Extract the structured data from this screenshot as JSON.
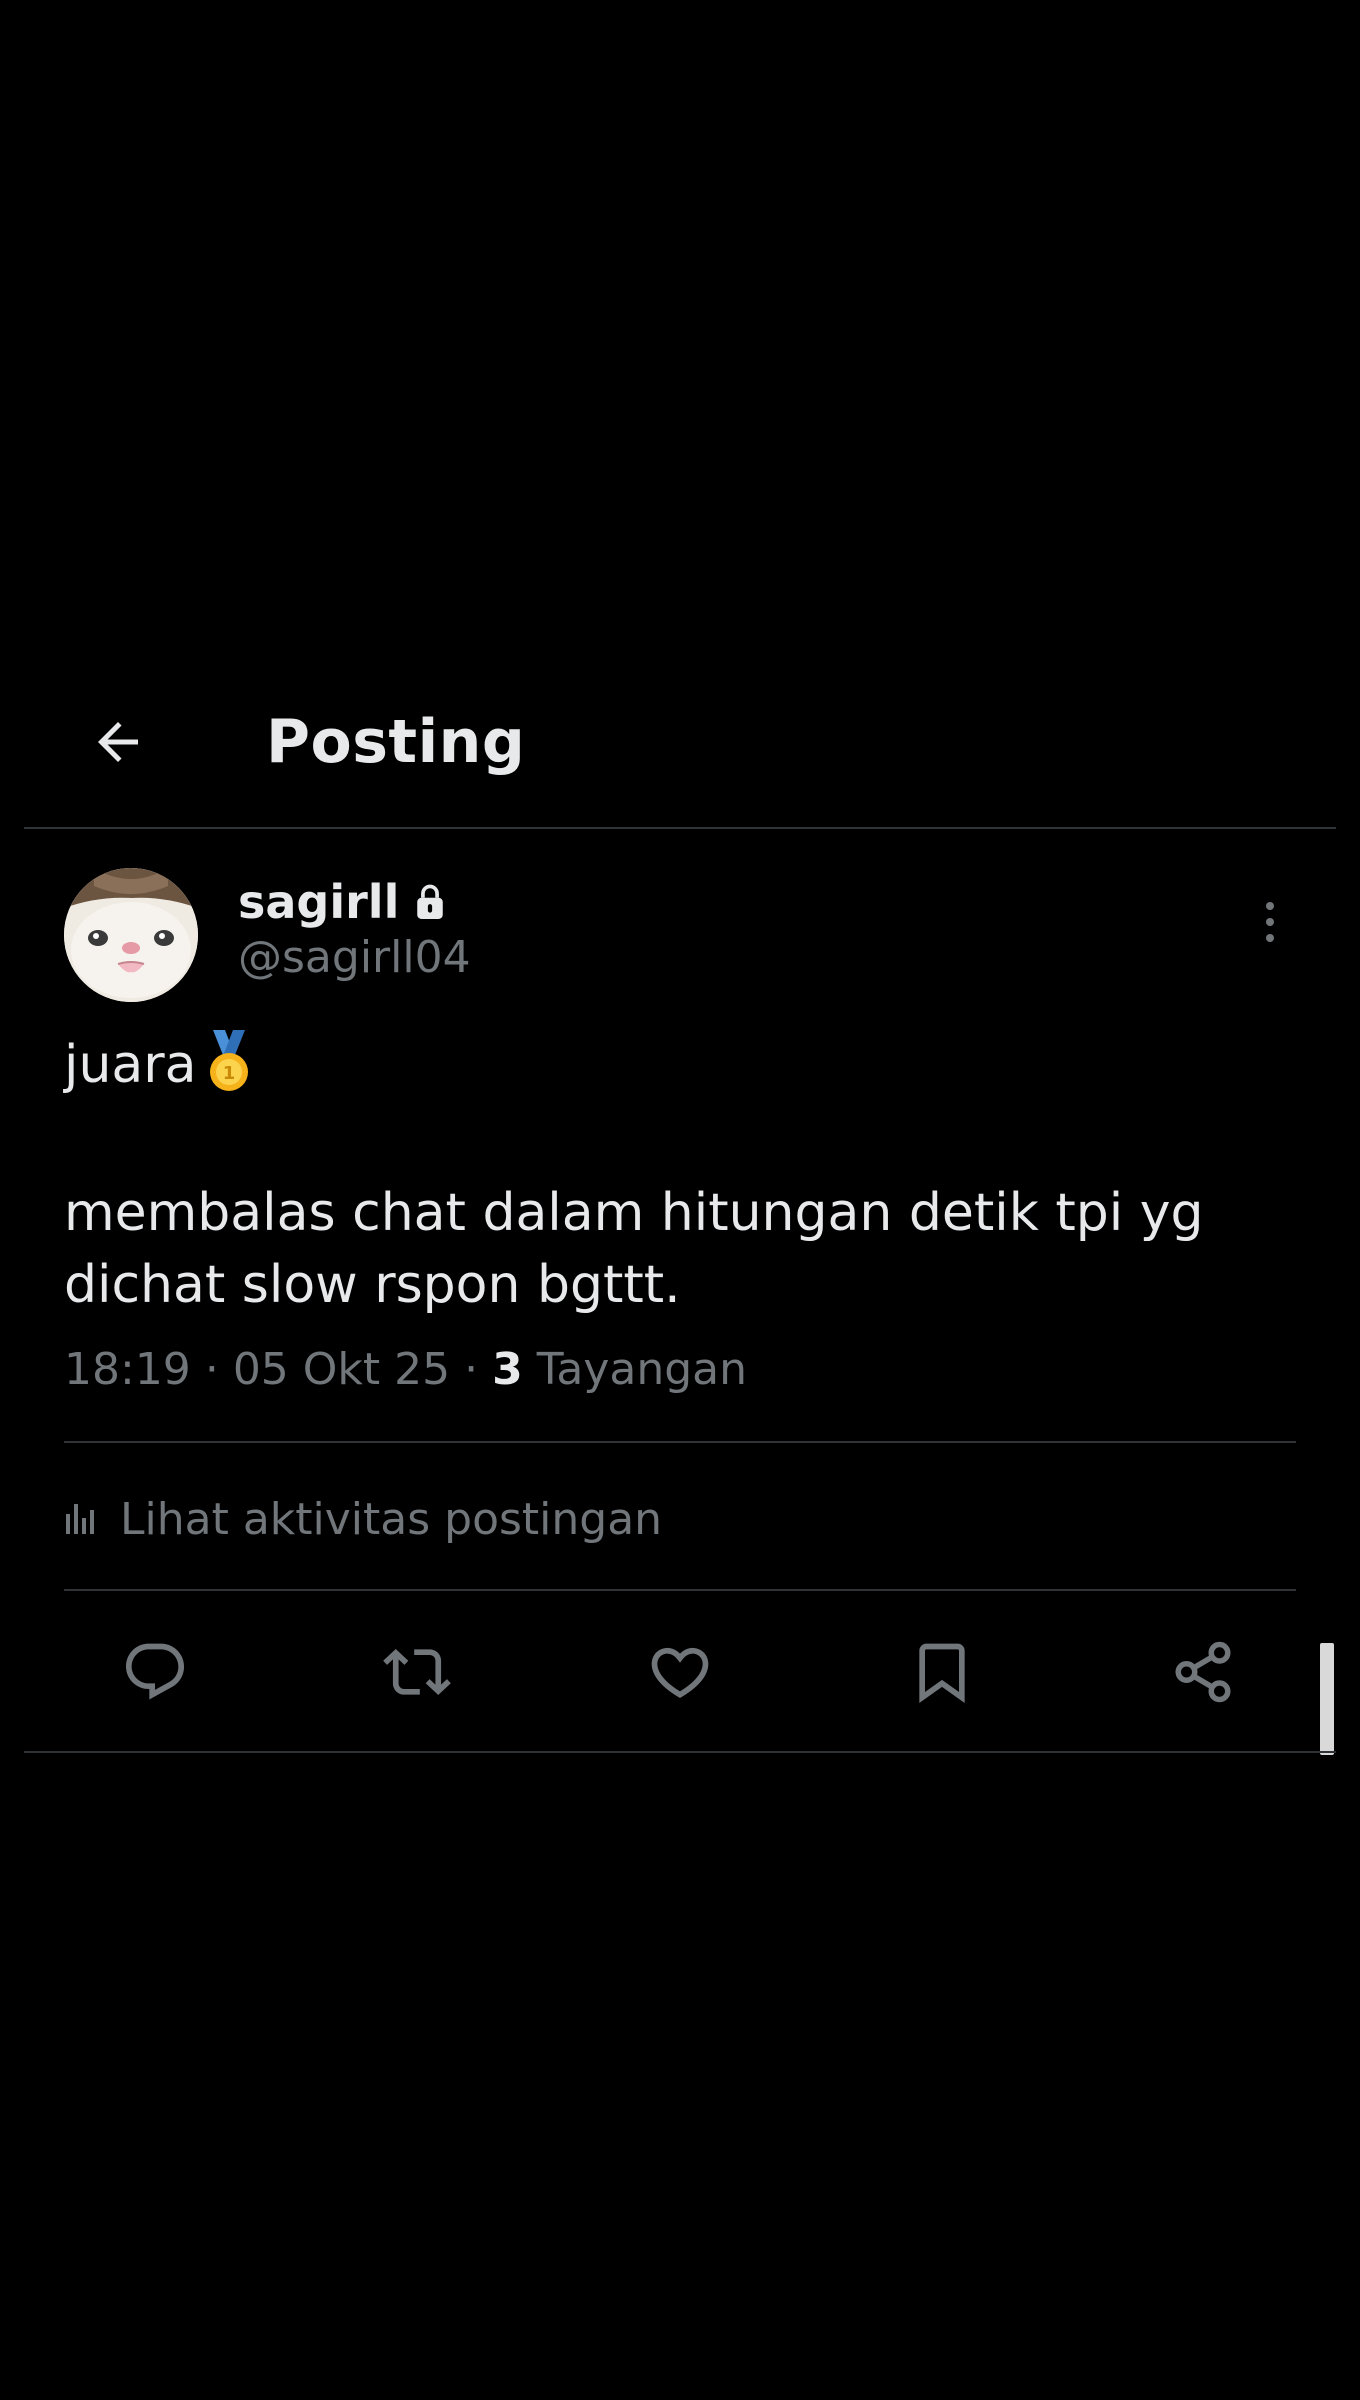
{
  "header": {
    "title": "Posting",
    "back_icon": "arrow-left-icon"
  },
  "post": {
    "author": {
      "display_name": "sagirll",
      "handle": "@sagirll04",
      "protected_icon": "lock-icon",
      "avatar": "cat-avatar"
    },
    "text_line1": "juara",
    "text_emoji": "medal-icon",
    "text_line2": "membalas chat dalam hitungan detik tpi yg",
    "text_line3": "dichat slow rspon bgttt.",
    "time": "18:19",
    "separator": "·",
    "date": "05 Okt 25",
    "views_count": "3",
    "views_label": "Tayangan",
    "activity_label": "Lihat aktivitas postingan"
  },
  "actions": [
    {
      "name": "reply",
      "icon": "reply-icon"
    },
    {
      "name": "repost",
      "icon": "repost-icon"
    },
    {
      "name": "like",
      "icon": "heart-icon"
    },
    {
      "name": "bookmark",
      "icon": "bookmark-icon"
    },
    {
      "name": "share",
      "icon": "share-icon"
    }
  ],
  "colors": {
    "background": "#000000",
    "text_primary": "#e7e9ea",
    "text_secondary": "#71767b",
    "divider": "#2f3336"
  }
}
